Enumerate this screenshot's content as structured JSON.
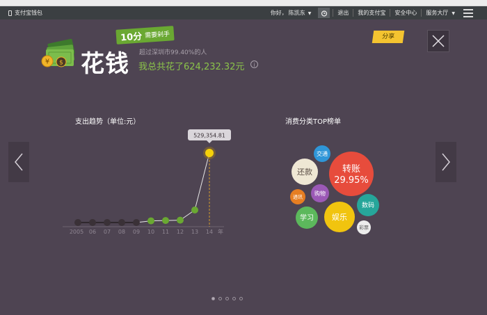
{
  "navbar": {
    "brand": "支付宝钱包",
    "greeting": "你好，",
    "username": "陈凯东",
    "logout": "退出",
    "my_alipay": "我的支付宝",
    "security": "安全中心",
    "service": "服务大厅"
  },
  "header": {
    "title": "花钱",
    "score": "10分",
    "score_text": "需要剁手",
    "subtitle": "超过深圳市99.40%的人",
    "total": "我总共花了624,232.32元",
    "share": "分享"
  },
  "trend": {
    "title": "支出趋势（单位:元）",
    "tooltip": "529,354.81",
    "unit": "年"
  },
  "chart_data": {
    "type": "line",
    "title": "支出趋势（单位:元）",
    "categories": [
      "2005",
      "06",
      "07",
      "08",
      "09",
      "10",
      "11",
      "12",
      "13",
      "14"
    ],
    "values": [
      0,
      0,
      0,
      0,
      0,
      1200,
      1500,
      1800,
      20000,
      529354.81
    ],
    "colors": [
      "#3a3137",
      "#3a3137",
      "#3a3137",
      "#3a3137",
      "#3a3137",
      "#6aa832",
      "#6aa832",
      "#6aa832",
      "#6aa832",
      "#f5d10a"
    ],
    "xlabel": "年",
    "ylim": [
      0,
      529354.81
    ],
    "grid": false
  },
  "top_list": {
    "title": "消费分类TOP榜单",
    "items": [
      {
        "label": "转账",
        "value": "29.95%",
        "color": "#e74c3c"
      },
      {
        "label": "还款",
        "color": "#efe7d4"
      },
      {
        "label": "交通",
        "color": "#2f96d8"
      },
      {
        "label": "购物",
        "color": "#9b59b6"
      },
      {
        "label": "通讯",
        "color": "#e67e22"
      },
      {
        "label": "学习",
        "color": "#5cb85c"
      },
      {
        "label": "娱乐",
        "color": "#f1c40f"
      },
      {
        "label": "数码",
        "color": "#26a69a"
      },
      {
        "label": "彩票",
        "color": "#ececec"
      }
    ]
  },
  "pager": {
    "count": 5,
    "active": 0
  }
}
